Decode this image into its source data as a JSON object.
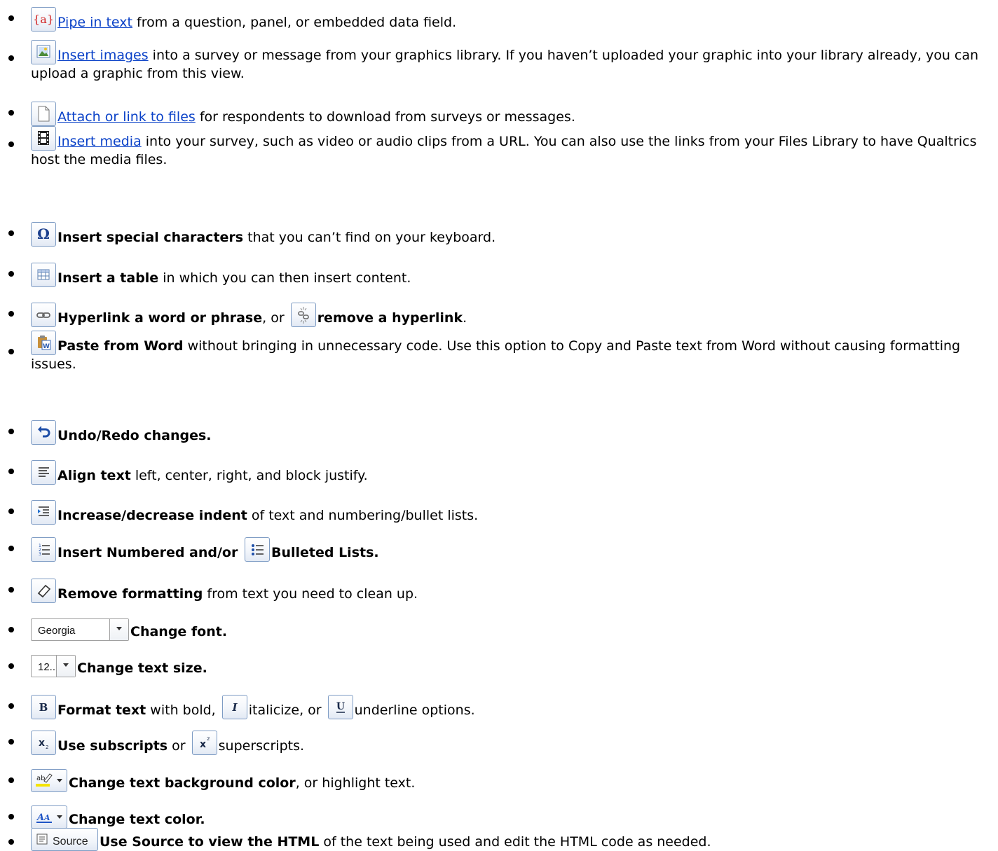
{
  "items": [
    {
      "icon": "pipe-text-icon",
      "link": "Pipe in text",
      "text": " from a question, panel, or embedded data field."
    },
    {
      "icon": "insert-image-icon",
      "link": "Insert images",
      "text": " into a survey or message from your graphics library. If you haven’t uploaded your graphic into your library already, you can upload a graphic from this view."
    },
    {
      "icon": "file-icon",
      "link": "Attach or link to files",
      "text": " for respondents to download from surveys or messages."
    },
    {
      "icon": "film-icon",
      "link": "Insert media",
      "text": " into your survey, such as video or audio clips from a URL. You can also use the links from your Files Library to have Qualtrics host the media files."
    },
    {
      "icon": "omega-icon",
      "bold": "Insert special characters",
      "text": " that you can’t find on your keyboard."
    },
    {
      "icon": "table-icon",
      "bold": "Insert a table",
      "text": " in which you can then insert content."
    },
    {
      "icon": "link-icon",
      "bold": "Hyperlink a word or phrase",
      "mid": ", or ",
      "icon2": "unlink-icon",
      "bold2": "remove a hyperlink",
      "tail": "."
    },
    {
      "icon": "paste-word-icon",
      "bold": "Paste from Word",
      "text": " without bringing in unnecessary code. Use this option to Copy and Paste text from Word without causing formatting issues."
    },
    {
      "icon": "undo-icon",
      "bold": "Undo/Redo changes."
    },
    {
      "icon": "align-left-icon",
      "bold": "Align text",
      "text": " left, center, right, and block justify."
    },
    {
      "icon": "indent-icon",
      "bold": "Increase/decrease indent",
      "text": " of text and numbering/bullet lists."
    },
    {
      "icon": "numbered-list-icon",
      "bold": "Insert Numbered and/or ",
      "icon2": "bulleted-list-icon",
      "bold2": "Bulleted Lists."
    },
    {
      "icon": "eraser-icon",
      "bold": "Remove formatting",
      "text": " from text you need to clean up."
    },
    {
      "font_value": "Georgia",
      "bold": "Change font."
    },
    {
      "size_value": "12...",
      "bold": "Change text size."
    },
    {
      "icon": "bold-icon",
      "bold": "Format text",
      "mid": " with bold, ",
      "icon2": "italic-icon",
      "mid2": "italicize, or ",
      "icon3": "underline-icon",
      "tail": "underline options."
    },
    {
      "icon": "subscript-icon",
      "bold": "Use subscripts",
      "mid": " or ",
      "icon2": "superscript-icon",
      "tail": "superscripts."
    },
    {
      "icon": "highlight-icon",
      "bold": "Change text background color",
      "text": ", or highlight text."
    },
    {
      "icon": "text-color-icon",
      "bold": "Change text color."
    },
    {
      "source_label": "Source",
      "bold": "Use Source to view the HTML",
      "text": " of the text being used and edit the HTML code as needed."
    }
  ],
  "colors": {
    "link": "#0b42c8",
    "button_border": "#7e9cc4",
    "highlight": "#f5e400",
    "text_color_icon": "#1f55c6"
  }
}
